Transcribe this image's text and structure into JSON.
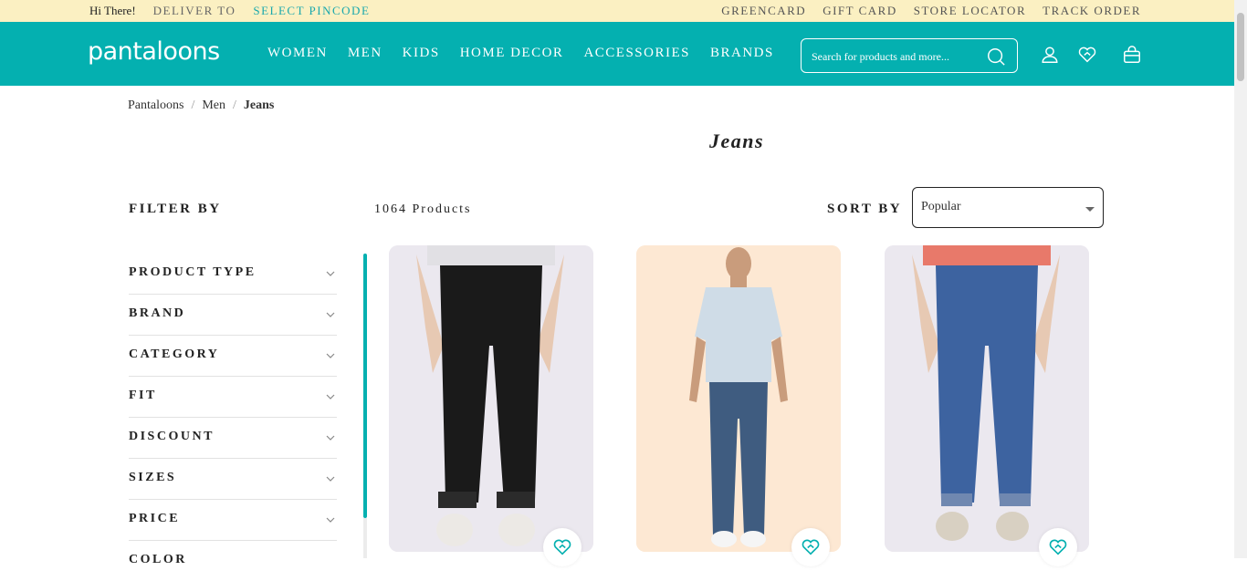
{
  "topbar": {
    "greeting": "Hi There!",
    "deliver_to": "DELIVER TO",
    "select_pincode": "SELECT PINCODE",
    "links": [
      "GREENCARD",
      "GIFT CARD",
      "STORE LOCATOR",
      "TRACK ORDER"
    ]
  },
  "header": {
    "logo": "pantaloons",
    "nav": [
      "WOMEN",
      "MEN",
      "KIDS",
      "HOME DECOR",
      "ACCESSORIES",
      "BRANDS"
    ],
    "search_placeholder": "Search for products and more...",
    "icons": [
      "user-icon",
      "heart-icon",
      "bag-icon"
    ],
    "accent_color": "#04b0b0"
  },
  "breadcrumb": [
    "Pantaloons",
    "Men",
    "Jeans"
  ],
  "page_title": "Jeans",
  "filter_by_label": "FILTER BY",
  "product_count": "1064 Products",
  "sort": {
    "label": "SORT BY",
    "value": "Popular"
  },
  "filters": [
    "PRODUCT TYPE",
    "BRAND",
    "CATEGORY",
    "FIT",
    "DISCOUNT",
    "SIZES",
    "PRICE",
    "COLOR"
  ],
  "products": [
    {
      "image": "black-slim-jeans",
      "color": "#1a1a1a"
    },
    {
      "image": "model-blue-jeans-printed-polo",
      "color": "#3f5c80"
    },
    {
      "image": "mid-blue-jeans",
      "color": "#3d63a0"
    }
  ]
}
